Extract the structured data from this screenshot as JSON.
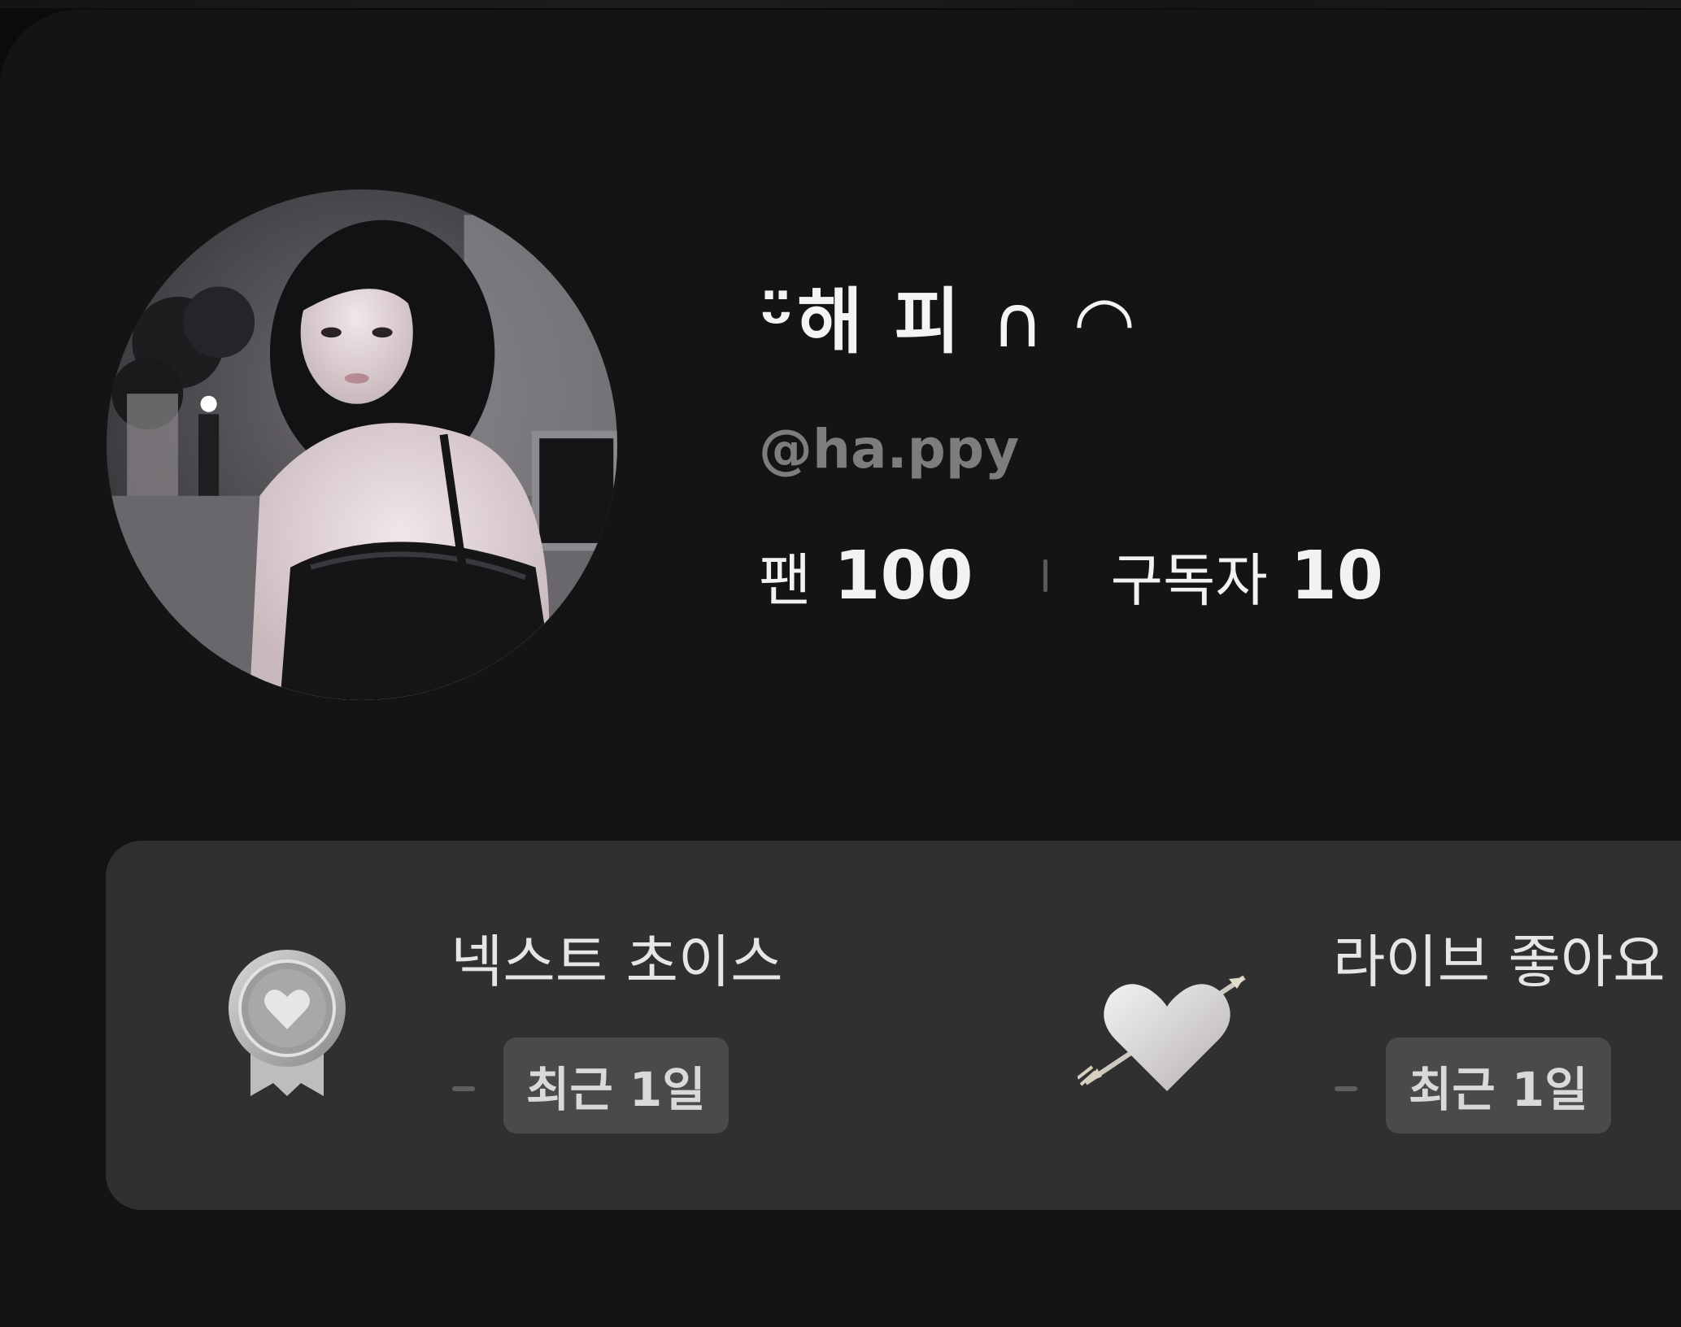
{
  "profile": {
    "display_name": "ᵕ̈해 피 ︎ ∩ ︎",
    "name_parts": {
      "emoji": "ᵕ̈",
      "text": "해 피",
      "tail": "∩ ◠"
    },
    "handle": "@ha.ppy",
    "avatar_icon": "profile-avatar-image",
    "stats": {
      "fans_label": "팬",
      "fans_value": "100",
      "subscribers_label": "구독자",
      "subscribers_value": "10"
    }
  },
  "badges": [
    {
      "icon": "medal-heart-icon",
      "title": "넥스트 초이스",
      "period": "최근 1일"
    },
    {
      "icon": "heart-arrow-icon",
      "title": "라이브 좋아요",
      "period": "최근 1일"
    }
  ],
  "colors": {
    "background": "#141414",
    "panel": "#303030",
    "text_primary": "#f4f4f4",
    "text_secondary": "#7d7d7d",
    "pill": "#4a4a4a"
  }
}
